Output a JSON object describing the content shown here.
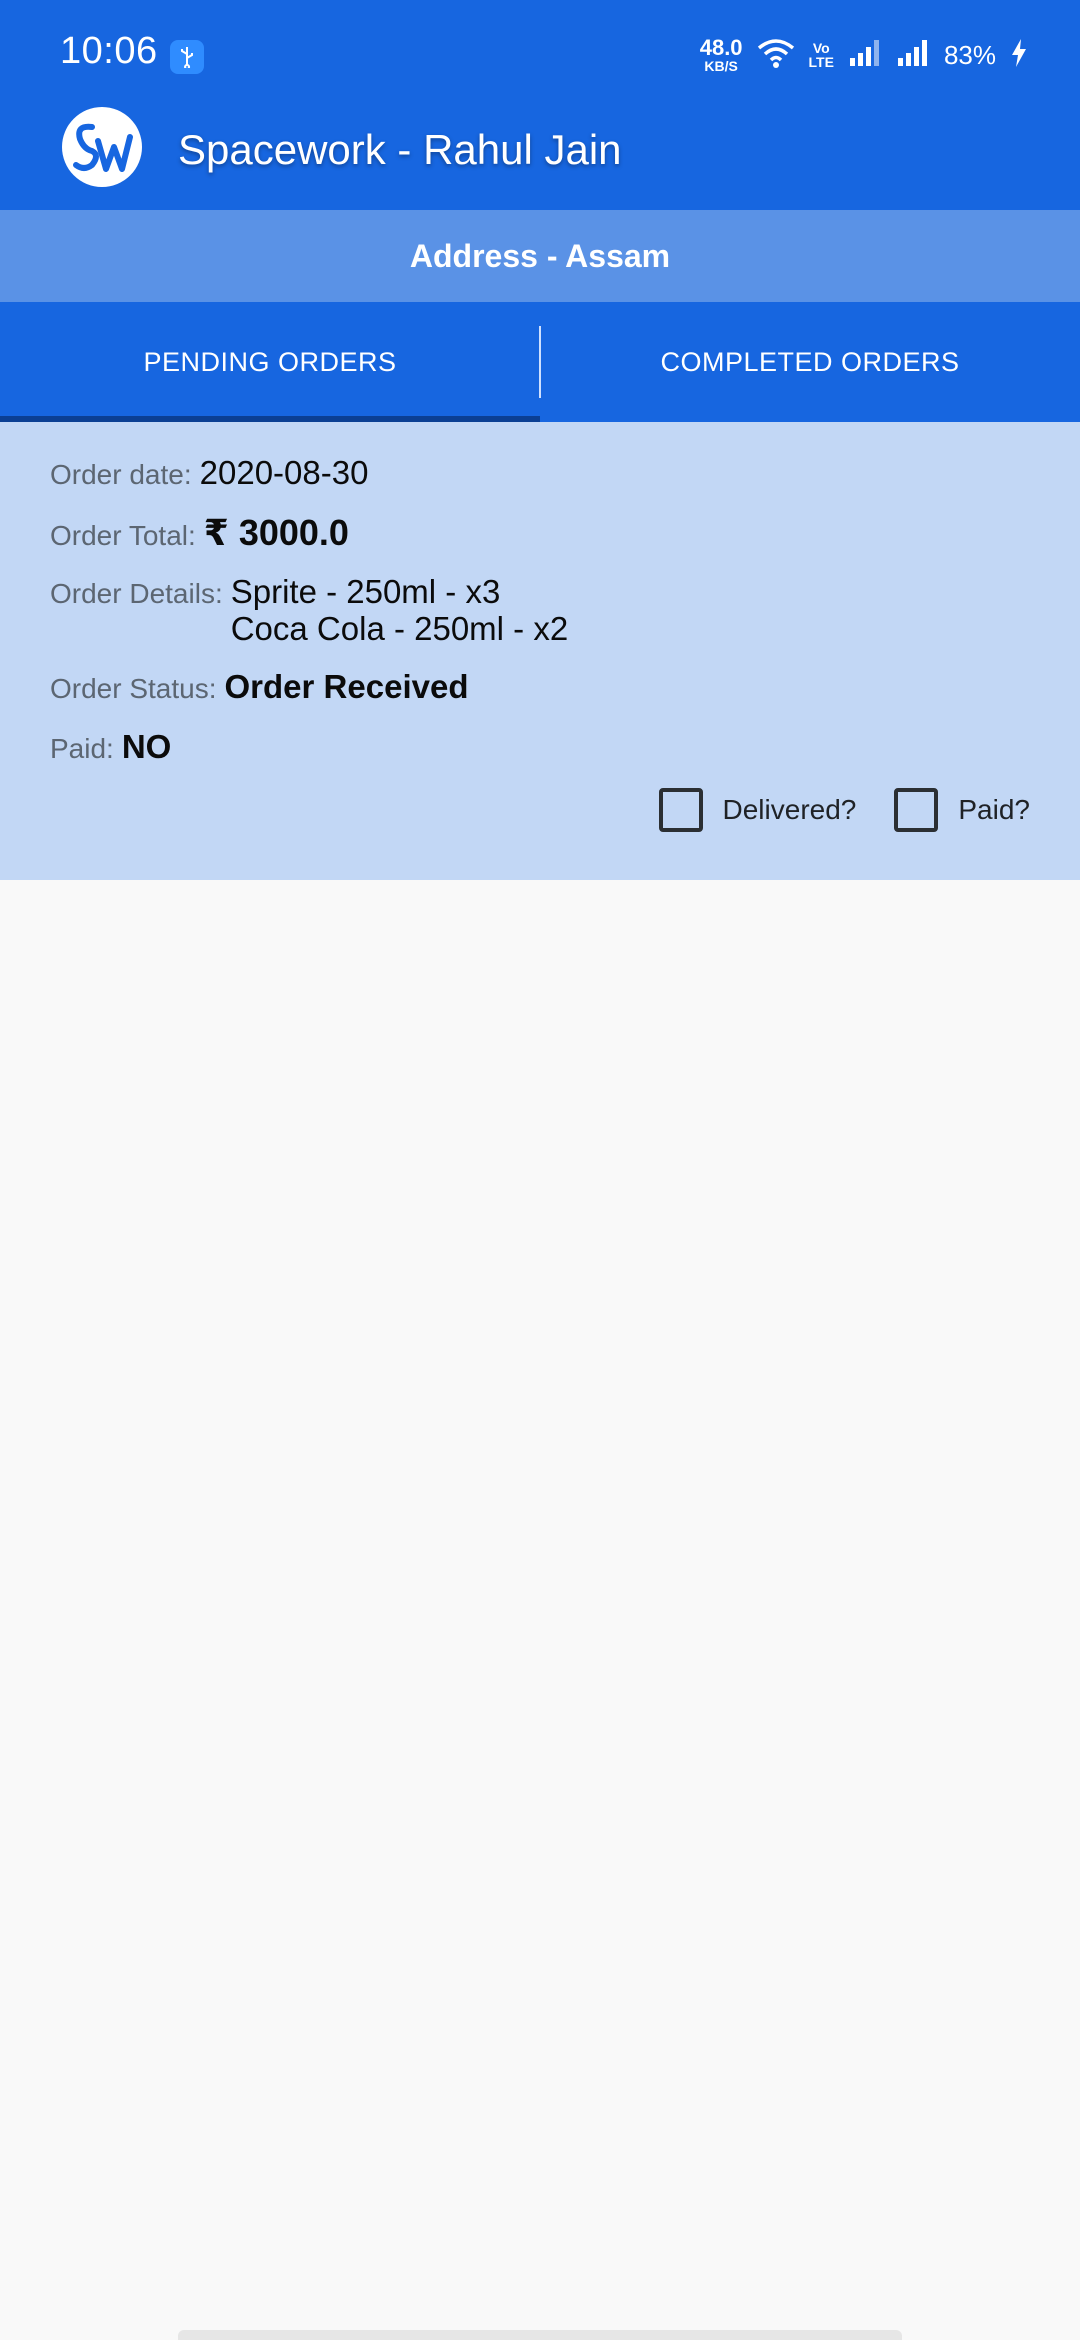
{
  "status_bar": {
    "time": "10:06",
    "net_speed_value": "48.0",
    "net_speed_unit": "KB/S",
    "volte_line1": "Vo",
    "volte_line2": "LTE",
    "battery": "83%",
    "icons": [
      "usb-icon",
      "wifi-icon",
      "volte-icon",
      "signal-icon",
      "signal-icon",
      "charging-icon"
    ]
  },
  "app_bar": {
    "logo_icon": "spacework-logo",
    "title": "Spacework - Rahul Jain"
  },
  "address": {
    "text": "Address - Assam"
  },
  "tabs": [
    {
      "label": "PENDING ORDERS",
      "active": true
    },
    {
      "label": "COMPLETED ORDERS",
      "active": false
    }
  ],
  "order": {
    "date_label": "Order date:",
    "date_value": "2020-08-30",
    "total_label": "Order Total:",
    "total_value": "₹ 3000.0",
    "details_label": "Order Details:",
    "details_lines": [
      "Sprite - 250ml - x3",
      "Coca Cola - 250ml - x2"
    ],
    "status_label": "Order Status:",
    "status_value": "Order Received",
    "paid_label": "Paid:",
    "paid_value": "NO",
    "delivered_checkbox_label": "Delivered?",
    "delivered_checked": false,
    "paid_checkbox_label": "Paid?",
    "paid_checked": false
  },
  "colors": {
    "primary": "#1766e0",
    "address_bar": "#5a92e6",
    "card_background": "#c2d7f5",
    "tab_indicator": "#0b3f93"
  }
}
